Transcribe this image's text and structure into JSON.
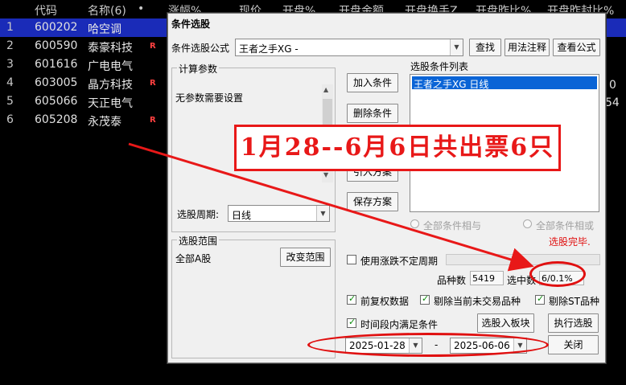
{
  "table": {
    "headers": [
      "代码",
      "名称(6)",
      "•",
      "涨幅%",
      "现价",
      "开盘%",
      "开盘金额",
      "开盘换手Z",
      "开盘昨比%",
      "开盘昨封比%"
    ],
    "rows": [
      {
        "idx": "1",
        "code": "600202",
        "name": "哈空调",
        "badge": ""
      },
      {
        "idx": "2",
        "code": "600590",
        "name": "泰豪科技",
        "badge": "R"
      },
      {
        "idx": "3",
        "code": "601616",
        "name": "广电电气",
        "badge": ""
      },
      {
        "idx": "4",
        "code": "603005",
        "name": "晶方科技",
        "badge": "R"
      },
      {
        "idx": "5",
        "code": "605066",
        "name": "天正电气",
        "badge": ""
      },
      {
        "idx": "6",
        "code": "605208",
        "name": "永茂泰",
        "badge": "R"
      }
    ],
    "right_fragments": [
      "0",
      "54"
    ]
  },
  "dialog": {
    "title": "条件选股",
    "formula_label": "条件选股公式",
    "formula_value": "王者之手XG  -",
    "btn_find": "查找",
    "btn_usage": "用法注释",
    "btn_view": "查看公式",
    "calc_params_caption": "计算参数",
    "calc_params_text": "无参数需要设置",
    "period_label": "选股周期:",
    "period_value": "日线",
    "btn_add": "加入条件",
    "btn_delete": "删除条件",
    "btn_import": "引入方案",
    "btn_save": "保存方案",
    "cond_list_label": "选股条件列表",
    "cond_list_item": "王者之手XG  日线",
    "radio_and": "全部条件相与",
    "radio_or": "全部条件相或",
    "status": "选股完毕.",
    "range_caption": "选股范围",
    "range_value": "全部A股",
    "btn_change_range": "改变范围",
    "chk_uncertain": "使用涨跌不定周期",
    "count_label": "品种数",
    "count_value": "5419",
    "selected_label": "选中数",
    "selected_value": "6/0.1%",
    "chk_prerights": "前复权数据",
    "chk_exclude_untraded": "剔除当前未交易品种",
    "chk_exclude_st": "剔除ST品种",
    "chk_period": "时间段内满足条件",
    "btn_to_board": "选股入板块",
    "btn_execute": "执行选股",
    "date_from": "2025-01-28",
    "date_sep": "-",
    "date_to": "2025-06-06",
    "btn_close": "关闭"
  },
  "annotation": {
    "banner": "1月28--6月6日共出票6只",
    "color": "#e81818"
  },
  "colors": {
    "selected_row": "#1a2bb8",
    "badge_red": "#ff4040",
    "list_selection": "#0a64d6"
  }
}
